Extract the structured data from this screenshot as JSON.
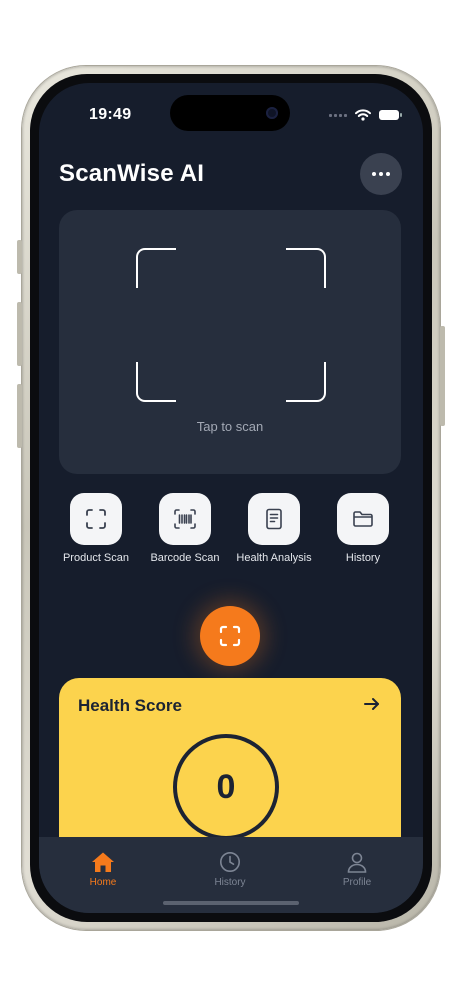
{
  "status_bar": {
    "time": "19:49"
  },
  "header": {
    "title": "ScanWise AI",
    "more_icon": "ellipsis-icon"
  },
  "scanner": {
    "hint": "Tap to scan",
    "frame_icon": "scan-frame-icon"
  },
  "quick_actions": [
    {
      "label": "Product Scan",
      "icon": "scan-icon"
    },
    {
      "label": "Barcode Scan",
      "icon": "barcode-icon"
    },
    {
      "label": "Health Analysis",
      "icon": "document-icon"
    },
    {
      "label": "History",
      "icon": "folder-icon"
    }
  ],
  "fab": {
    "icon": "scan-icon"
  },
  "health_card": {
    "title": "Health Score",
    "score": "0",
    "arrow_icon": "arrow-right-icon"
  },
  "tab_bar": {
    "tabs": [
      {
        "label": "Home",
        "icon": "home-icon",
        "active": true
      },
      {
        "label": "History",
        "icon": "clock-icon",
        "active": false
      },
      {
        "label": "Profile",
        "icon": "person-icon",
        "active": false
      }
    ]
  },
  "colors": {
    "background": "#161d2c",
    "card": "#262e3d",
    "accent": "#f57a1c",
    "health_card": "#fcd34d",
    "text_dark": "#1c2333"
  }
}
